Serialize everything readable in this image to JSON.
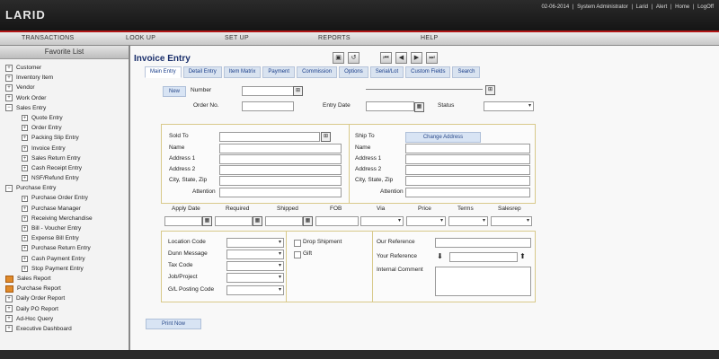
{
  "app": {
    "logo": "LARID"
  },
  "top_links": {
    "date": "02-06-2014",
    "user": "System Administrator",
    "items": [
      "Larid",
      "Alert",
      "Home",
      "LogOff"
    ]
  },
  "menu": [
    "TRANSACTIONS",
    "LOOK UP",
    "SET UP",
    "REPORTS",
    "HELP"
  ],
  "sidebar": {
    "title": "Favorite List",
    "items": [
      {
        "label": "Customer",
        "type": "node"
      },
      {
        "label": "Inventory Item",
        "type": "node"
      },
      {
        "label": "Vendor",
        "type": "node"
      },
      {
        "label": "Work Order",
        "type": "node"
      },
      {
        "label": "Sales Entry",
        "type": "node-open"
      },
      {
        "label": "Quote Entry",
        "type": "sub"
      },
      {
        "label": "Order Entry",
        "type": "sub"
      },
      {
        "label": "Packing Slip Entry",
        "type": "sub"
      },
      {
        "label": "Invoice Entry",
        "type": "sub"
      },
      {
        "label": "Sales Return Entry",
        "type": "sub"
      },
      {
        "label": "Cash Receipt Entry",
        "type": "sub"
      },
      {
        "label": "NSF/Refund Entry",
        "type": "sub"
      },
      {
        "label": "Purchase Entry",
        "type": "node-open"
      },
      {
        "label": "Purchase Order Entry",
        "type": "sub"
      },
      {
        "label": "Purchase Manager",
        "type": "sub"
      },
      {
        "label": "Receiving Merchandise",
        "type": "sub"
      },
      {
        "label": "Bill - Voucher Entry",
        "type": "sub"
      },
      {
        "label": "Expense Bill Entry",
        "type": "sub"
      },
      {
        "label": "Purchase Return Entry",
        "type": "sub"
      },
      {
        "label": "Cash Payment Entry",
        "type": "sub"
      },
      {
        "label": "Stop Payment Entry",
        "type": "sub"
      },
      {
        "label": "Sales Report",
        "type": "report"
      },
      {
        "label": "Purchase Report",
        "type": "report"
      },
      {
        "label": "Daily Order Report",
        "type": "node"
      },
      {
        "label": "Daily PO Report",
        "type": "node"
      },
      {
        "label": "Ad-Hoc Query",
        "type": "node"
      },
      {
        "label": "Executive Dashboard",
        "type": "node"
      }
    ]
  },
  "page": {
    "title": "Invoice Entry"
  },
  "tabs": [
    "Main Entry",
    "Detail Entry",
    "Item Matrix",
    "Payment",
    "Commission",
    "Options",
    "Serial/Lot",
    "Custom Fields",
    "Search"
  ],
  "header_fields": {
    "new_button": "New",
    "number": "Number",
    "order_no": "Order No.",
    "entry_date": "Entry Date",
    "status": "Status"
  },
  "sold_to": {
    "title": "Sold To",
    "name": "Name",
    "address1": "Address 1",
    "address2": "Address 2",
    "city": "City, State, Zip",
    "attention": "Attention"
  },
  "ship_to": {
    "title": "Ship To",
    "change_address": "Change Address",
    "name": "Name",
    "address1": "Address 1",
    "address2": "Address 2",
    "city": "City, State, Zip",
    "attention": "Attention"
  },
  "grid_headers": [
    "Apply Date",
    "Required",
    "Shipped",
    "FOB",
    "Via",
    "Price",
    "Terms",
    "Salesrep"
  ],
  "codes": {
    "location": "Location Code",
    "dunn": "Dunn Message",
    "tax": "Tax Code",
    "job": "Job/Project",
    "gl": "G/L Posting Code"
  },
  "checks": {
    "drop": "Drop Shipment",
    "gift": "Gift"
  },
  "refs": {
    "our": "Our Reference",
    "your": "Your Reference",
    "internal": "Internal Comment"
  },
  "print_now": "Print Now",
  "icons": {
    "calendar": "calendar-icon",
    "lookup": "lookup-icon"
  }
}
